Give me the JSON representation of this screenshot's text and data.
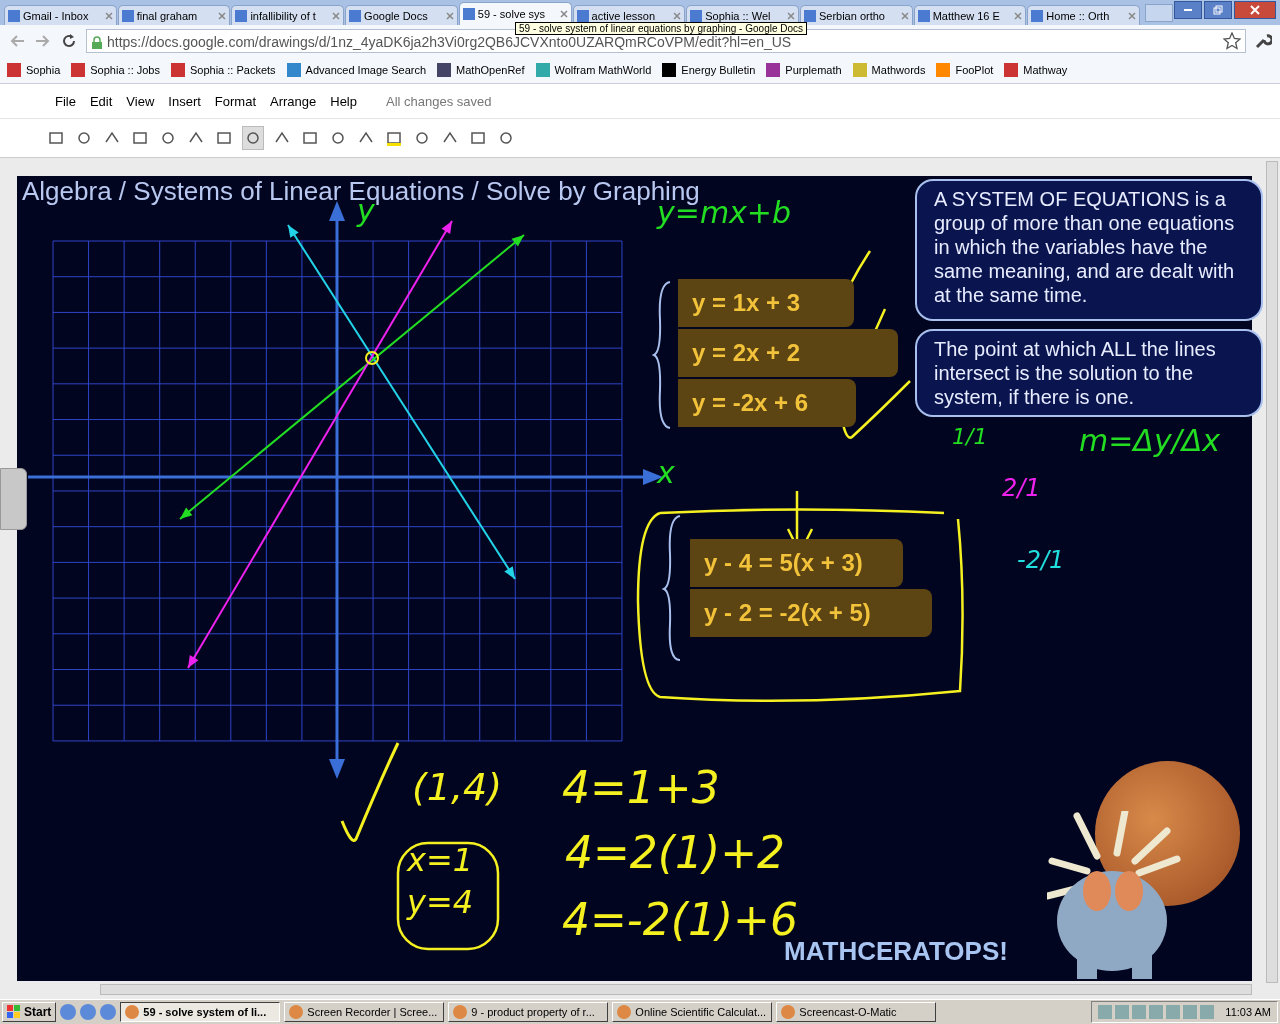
{
  "tabs": [
    {
      "title": "Gmail - Inbox",
      "selected": false
    },
    {
      "title": "final graham",
      "selected": false
    },
    {
      "title": "infallibility of t",
      "selected": false
    },
    {
      "title": "Google Docs",
      "selected": false
    },
    {
      "title": "59 - solve sys",
      "selected": true
    },
    {
      "title": "active lesson",
      "selected": false
    },
    {
      "title": "Sophia :: Wel",
      "selected": false
    },
    {
      "title": "Serbian ortho",
      "selected": false
    },
    {
      "title": "Matthew 16 E",
      "selected": false
    },
    {
      "title": "Home :: Orth",
      "selected": false
    }
  ],
  "address_bar": {
    "url": "https://docs.google.com/drawings/d/1nz_4yaDK6ja2h3Vi0rg2QB6JCVXnto0UZARQmRCoVPM/edit?hl=en_US"
  },
  "tooltip": "59 - solve system of linear equations by graphing - Google Docs",
  "bookmarks": [
    "Sophia",
    "Sophia :: Jobs",
    "Sophia :: Packets",
    "Advanced Image Search",
    "MathOpenRef",
    "Wolfram MathWorld",
    "Energy Bulletin",
    "Purplemath",
    "Mathwords",
    "FooPlot",
    "Mathway"
  ],
  "menu": [
    "File",
    "Edit",
    "View",
    "Insert",
    "Format",
    "Arrange",
    "Help"
  ],
  "save_status": "All changes saved",
  "slide": {
    "title": "Algebra / Systems of Linear Equations / Solve by Graphing",
    "system_1": [
      "y = 1x + 3",
      "y = 2x + 2",
      "y = -2x + 6"
    ],
    "system_2": [
      "y - 4 = 5(x + 3)",
      "y - 2 = -2(x + 5)"
    ],
    "definitions": [
      "A SYSTEM OF EQUATIONS is a group of more than one equations in which the variables have the same meaning, and are dealt with at the same time.",
      "The point at which ALL the lines intersect is the solution to the system, if there is one."
    ],
    "brand": "MATHCERATOPS!",
    "ink_notes": [
      {
        "text": "y=mx+b",
        "color": "#22dd22"
      },
      {
        "text": "y",
        "color": "#22dd22"
      },
      {
        "text": "x",
        "color": "#22dd22"
      },
      {
        "text": "1/1",
        "color": "#22dd22"
      },
      {
        "text": "m=Δy/Δx",
        "color": "#22dd22"
      },
      {
        "text": "2/1",
        "color": "#ee22ee"
      },
      {
        "text": "-2/1",
        "color": "#22dddd"
      },
      {
        "text": "(1,4)",
        "color": "#f5f020"
      },
      {
        "text": "x=1",
        "color": "#f5f020"
      },
      {
        "text": "y=4",
        "color": "#f5f020"
      },
      {
        "text": "4=1+3",
        "color": "#f5f020"
      },
      {
        "text": "4=2(1)+2",
        "color": "#f5f020"
      },
      {
        "text": "4=-2(1)+6",
        "color": "#f5f020"
      }
    ]
  },
  "taskbar": {
    "start": "Start",
    "tasks": [
      {
        "title": "59 - solve system of li...",
        "selected": true
      },
      {
        "title": "Screen Recorder | Scree...",
        "selected": false
      },
      {
        "title": "9 - product property of r...",
        "selected": false
      },
      {
        "title": "Online Scientific Calculat...",
        "selected": false
      },
      {
        "title": "Screencast-O-Matic",
        "selected": false
      }
    ],
    "clock": "11:03 AM"
  }
}
